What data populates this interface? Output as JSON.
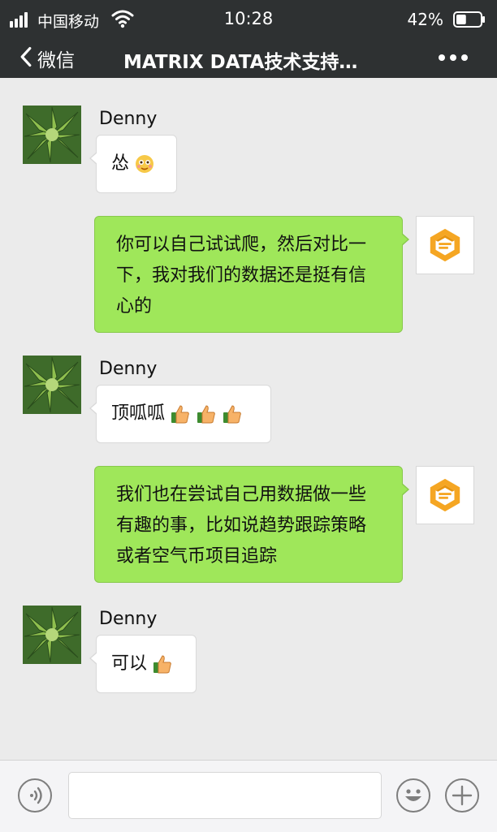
{
  "status_bar": {
    "carrier": "中国移动",
    "time": "10:28",
    "battery_percent": "42%",
    "battery_level": 0.42,
    "signal_icon": "signal-bars-icon",
    "wifi_icon": "wifi-icon"
  },
  "nav": {
    "back_label": "微信",
    "title": "MATRIX DATA技术支持…",
    "more_icon": "more-dots-icon"
  },
  "messages": [
    {
      "direction": "incoming",
      "sender": "Denny",
      "text": "怂",
      "emojis": [
        "blush-face-emoji"
      ]
    },
    {
      "direction": "outgoing",
      "lines": [
        "你可以自己试试爬，然后对比一",
        "下，我对我们的数据还是挺有信",
        "心的"
      ]
    },
    {
      "direction": "incoming",
      "sender": "Denny",
      "text": "顶呱呱",
      "emojis": [
        "thumbs-up-emoji",
        "thumbs-up-emoji",
        "thumbs-up-emoji"
      ]
    },
    {
      "direction": "outgoing",
      "lines": [
        "我们也在尝试自己用数据做一些",
        "有趣的事，比如说趋势跟踪策略",
        "或者空气币项目追踪"
      ]
    },
    {
      "direction": "incoming",
      "sender": "Denny",
      "text": "可以",
      "emojis": [
        "thumbs-up-emoji"
      ]
    }
  ],
  "input_bar": {
    "text_value": "",
    "icons": [
      "voice-icon",
      "emoji-face-icon",
      "plus-icon"
    ]
  },
  "colors": {
    "nav_background": "#2e3132",
    "chat_background": "#ebebeb",
    "outgoing_bubble": "#9fe75a",
    "incoming_bubble": "#ffffff",
    "logo_orange": "#f5a623"
  }
}
